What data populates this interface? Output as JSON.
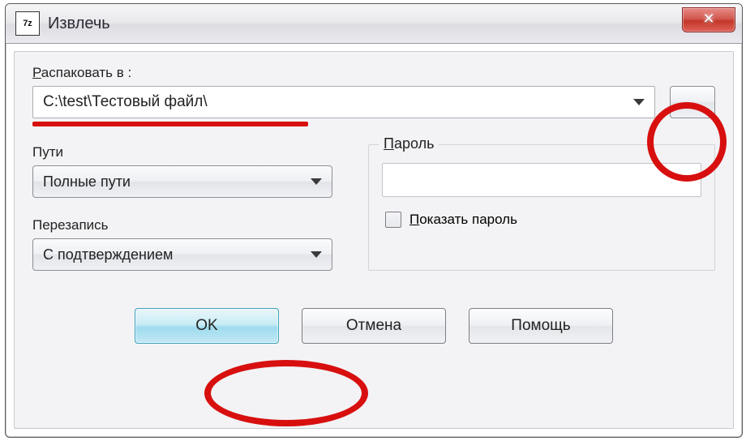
{
  "window": {
    "title": "Извлечь"
  },
  "labels": {
    "extract_to": "Распаковать в :",
    "paths": "Пути",
    "overwrite": "Перезапись",
    "password": "Пароль",
    "show_password": "Показать пароль"
  },
  "fields": {
    "extract_path": "C:\\test\\Тестовый файл\\",
    "paths_mode": "Полные пути",
    "overwrite_mode": "С подтверждением",
    "password_value": ""
  },
  "buttons": {
    "browse": "...",
    "ok": "OK",
    "cancel": "Отмена",
    "help": "Помощь"
  },
  "icons": {
    "app": "7z"
  }
}
